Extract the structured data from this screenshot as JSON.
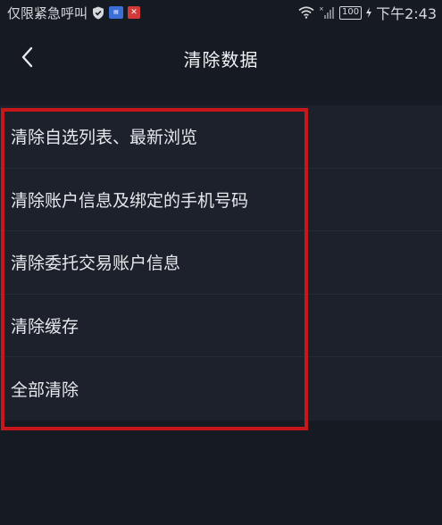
{
  "status_bar": {
    "carrier_text": "仅限紧急呼叫",
    "battery": "100",
    "time": "下午2:43",
    "icons": [
      "shield-icon",
      "app-blue-icon",
      "app-red-icon",
      "wifi-icon",
      "signal-icon",
      "battery-icon",
      "charging-icon"
    ]
  },
  "header": {
    "back_icon": "chevron-left-icon",
    "title": "清除数据"
  },
  "options": [
    {
      "label": "清除自选列表、最新浏览"
    },
    {
      "label": "清除账户信息及绑定的手机号码"
    },
    {
      "label": "清除委托交易账户信息"
    },
    {
      "label": "清除缓存"
    },
    {
      "label": "全部清除"
    }
  ],
  "colors": {
    "background": "#161a22",
    "list_background": "#1c212b",
    "text": "#e6e8ec",
    "highlight": "#c8171a"
  }
}
